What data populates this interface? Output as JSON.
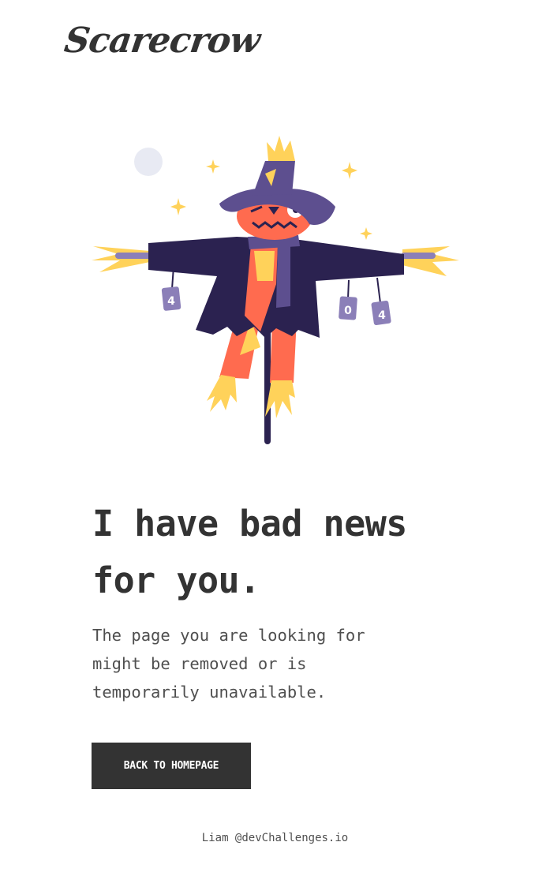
{
  "brand": {
    "logo_text": "Scarecrow"
  },
  "illustration": {
    "can_left": "4",
    "can_middle": "0",
    "can_right": "4"
  },
  "main": {
    "headline_line1": "I have bad news",
    "headline_line2": "for you.",
    "message_line1": "The page you are looking for",
    "message_line2": "might be removed or is",
    "message_line3": "temporarily unavailable.",
    "button_label": "BACK TO HOMEPAGE"
  },
  "footer": {
    "credit": "Liam @devChallenges.io"
  },
  "colors": {
    "text": "#333333",
    "body_text": "#4f4f4f",
    "button_bg": "#333333",
    "button_text": "#ffffff",
    "coat": "#2b2250",
    "hat": "#5d4f8f",
    "face": "#ff6b4f",
    "straw": "#ffd25a",
    "moon": "#e8eaf3"
  }
}
